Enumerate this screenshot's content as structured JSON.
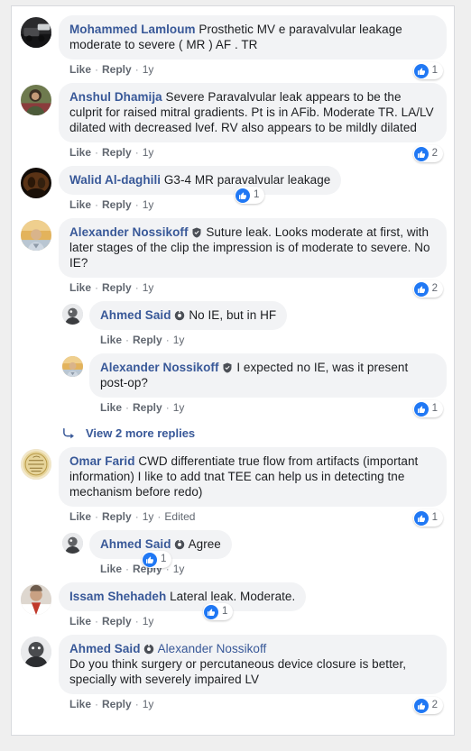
{
  "window": {
    "background_color": "#efefef",
    "card_background": "#ffffff",
    "bubble_color": "#f2f3f5",
    "link_color": "#385898",
    "like_blue": "#2078f4"
  },
  "actions": {
    "like": "Like",
    "reply": "Reply",
    "separator": "·",
    "edited": "Edited"
  },
  "view_more": {
    "label": "View 2 more replies",
    "icon": "curved-reply-arrow-icon"
  },
  "comments": [
    {
      "id": "c1",
      "author": "Mohammed Lamloum",
      "badge": null,
      "text": "Prosthetic MV e paravalvular leakage moderate to severe ( MR ) AF . TR",
      "time": "1y",
      "edited": false,
      "likes": "1",
      "avatar": "photo-dark-vehicle",
      "depth": 0
    },
    {
      "id": "c2",
      "author": "Anshul Dhamija",
      "badge": null,
      "text": "Severe Paravalvular leak appears to be the culprit for raised mitral gradients. Pt is in AFib. Moderate TR. LA/LV dilated with decreased lvef. RV also appears to be mildly dilated",
      "time": "1y",
      "edited": false,
      "likes": "2",
      "avatar": "photo-green-person",
      "depth": 0
    },
    {
      "id": "c3",
      "author": "Walid Al-daghili",
      "badge": null,
      "text": "G3-4 MR paravalvular leakage",
      "time": "1y",
      "edited": false,
      "likes": "1",
      "avatar": "photo-dark-brown",
      "depth": 0
    },
    {
      "id": "c4",
      "author": "Alexander Nossikoff",
      "badge": "shield-check-badge",
      "text": "Suture leak. Looks moderate at first, with later stages of the clip the impression is of moderate to severe. No IE?",
      "time": "1y",
      "edited": false,
      "likes": "2",
      "avatar": "photo-gold-portrait",
      "depth": 0
    },
    {
      "id": "c5",
      "author": "Ahmed Said",
      "badge": "ring-badge",
      "text": "No IE, but in HF",
      "time": "1y",
      "edited": false,
      "likes": null,
      "avatar": "photo-grey-face",
      "depth": 1
    },
    {
      "id": "c6",
      "author": "Alexander Nossikoff",
      "badge": "shield-check-badge",
      "text": "I expected no IE, was it present post-op?",
      "time": "1y",
      "edited": false,
      "likes": "1",
      "avatar": "photo-gold-portrait",
      "depth": 1
    },
    {
      "id": "c7",
      "author": "Omar Farid",
      "badge": null,
      "text": "CWD differentiate true flow from artifacts (important information) I like to add tnat TEE can help us in detecting tne mechanism before redo)",
      "time": "1y",
      "edited": true,
      "likes": "1",
      "avatar": "photo-gold-seal",
      "depth": 0
    },
    {
      "id": "c8",
      "author": "Ahmed Said",
      "badge": "ring-badge",
      "text": "Agree",
      "time": "1y",
      "edited": false,
      "likes": "1",
      "avatar": "photo-grey-face",
      "depth": 1
    },
    {
      "id": "c9",
      "author": "Issam Shehadeh",
      "badge": null,
      "text": "Lateral leak. Moderate.",
      "time": "1y",
      "edited": false,
      "likes": "1",
      "avatar": "photo-red-white",
      "depth": 0
    },
    {
      "id": "c10",
      "author": "Ahmed Said",
      "badge": "ring-badge",
      "mention": "Alexander Nossikoff",
      "text": "Do you think surgery or percutaneous device closure is better, specially with severely impaired LV",
      "time": "1y",
      "edited": false,
      "likes": "2",
      "avatar": "photo-bw-bearded",
      "depth": 0
    }
  ]
}
